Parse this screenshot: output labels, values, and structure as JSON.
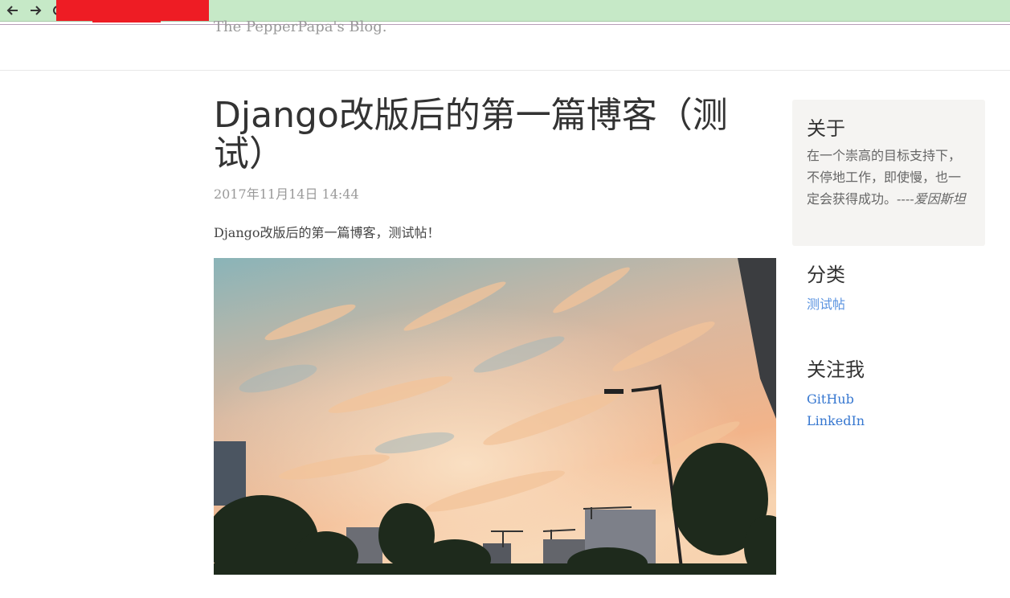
{
  "browser": {
    "url_fragment": "/"
  },
  "site": {
    "tagline": "The PepperPapa's Blog."
  },
  "post": {
    "title": "Django改版后的第一篇博客（测试）",
    "date": "2017年11月14日 14:44",
    "body": "Django改版后的第一篇博客，测试帖！"
  },
  "sidebar": {
    "about": {
      "heading": "关于",
      "quote": "在一个崇高的目标支持下，不停地工作，即使慢，也一定会获得成功。----",
      "author": "爱因斯坦"
    },
    "category": {
      "heading": "分类",
      "items": [
        {
          "label": "测试帖"
        }
      ]
    },
    "follow": {
      "heading": "关注我",
      "links": [
        {
          "label": "GitHub"
        },
        {
          "label": "LinkedIn"
        }
      ]
    }
  },
  "colors": {
    "browser_bar": "#c6e9c7",
    "link": "#3677d0",
    "about_bg": "#f5f4f2"
  }
}
